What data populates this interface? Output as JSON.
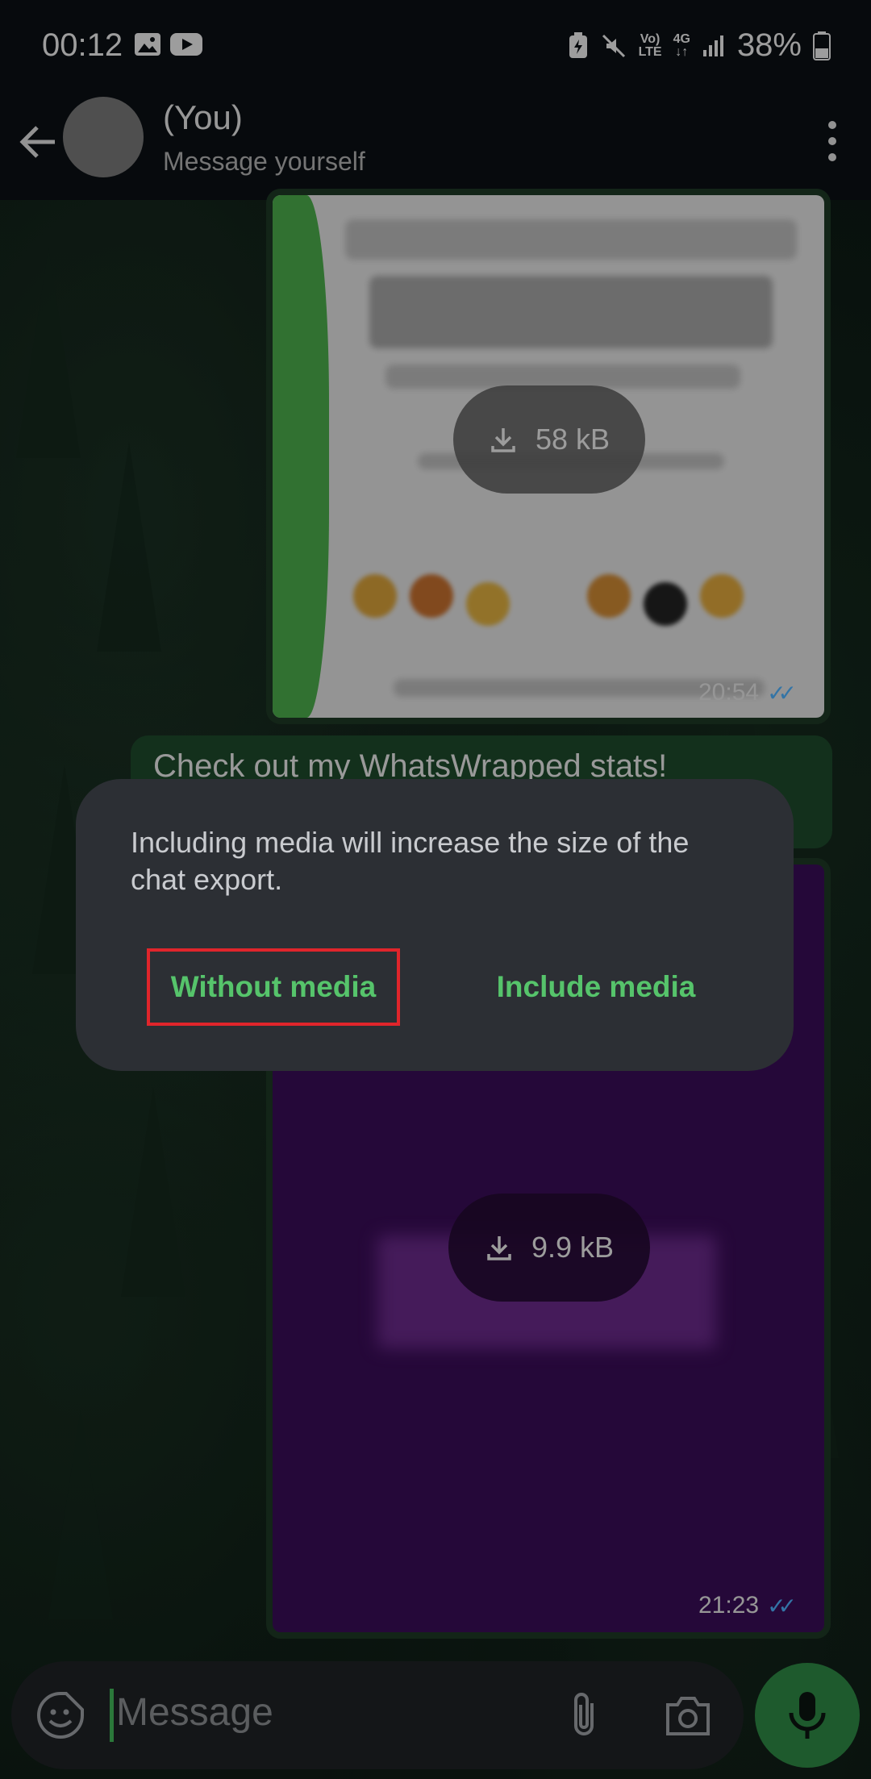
{
  "status_bar": {
    "time": "00:12",
    "network_top": "Vo)",
    "network_bottom": "LTE",
    "signal_gen": "4G",
    "battery": "38%"
  },
  "header": {
    "title": "(You)",
    "subtitle": "Message yourself"
  },
  "messages": [
    {
      "type": "image",
      "download_size": "58 kB",
      "time": "20:54",
      "ticks": "✓✓"
    },
    {
      "type": "text",
      "text": "Check out my WhatsWrapped stats!"
    },
    {
      "type": "image",
      "download_size": "9.9 kB",
      "time": "21:23",
      "ticks": "✓✓"
    }
  ],
  "dialog": {
    "message": "Including media will increase the size of the chat export.",
    "without_media": "Without media",
    "include_media": "Include media"
  },
  "input": {
    "placeholder": "Message"
  },
  "colors": {
    "accent": "#56c46b",
    "highlight_box": "#e0252b",
    "read_ticks": "#4fb3ff",
    "mic_button": "#2e8b45"
  }
}
